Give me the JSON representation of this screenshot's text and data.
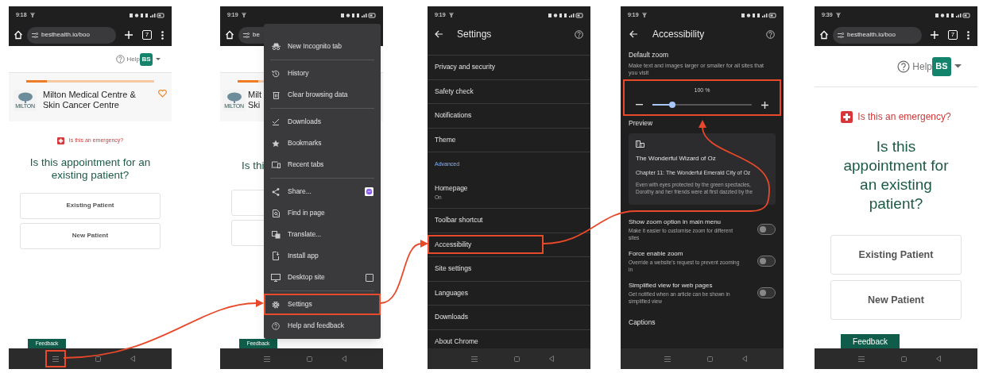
{
  "screens": [
    {
      "kind": "booking",
      "status_time": "9:18",
      "url": "besthealth.io/boo",
      "tab_count": "7",
      "help": "Help",
      "avatar": "BS",
      "clinic": {
        "name": "Milton Medical Centre & Skin Cancer Centre",
        "logo_text": "MILTON",
        "level": 0.16
      },
      "emergency": "Is this an emergency?",
      "question": "Is this appointment for an existing patient?",
      "options": [
        "Existing Patient",
        "New Patient"
      ],
      "feedback": "Feedback",
      "nav_highlighted": true
    },
    {
      "kind": "menu",
      "status_time": "9:19",
      "url": "be",
      "clinic": {
        "name_lines": [
          "Milt",
          "Ski"
        ],
        "logo_text": "MILTON",
        "level": 0.16
      },
      "question": "Is thi",
      "feedback": "Feedback",
      "menu": [
        {
          "kind": "item",
          "label": "New Incognito tab",
          "highlighted": false
        },
        {
          "kind": "divider"
        },
        {
          "kind": "item",
          "label": "History",
          "highlighted": false
        },
        {
          "kind": "item",
          "label": "Clear browsing data",
          "highlighted": false
        },
        {
          "kind": "divider"
        },
        {
          "kind": "item",
          "label": "Downloads",
          "highlighted": false
        },
        {
          "kind": "item",
          "label": "Bookmarks",
          "highlighted": false
        },
        {
          "kind": "item",
          "label": "Recent tabs",
          "highlighted": false
        },
        {
          "kind": "divider"
        },
        {
          "kind": "share",
          "label": "Share...",
          "highlighted": false
        },
        {
          "kind": "item",
          "label": "Find in page",
          "highlighted": false
        },
        {
          "kind": "item",
          "label": "Translate...",
          "highlighted": false
        },
        {
          "kind": "item",
          "label": "Install app",
          "highlighted": false
        },
        {
          "kind": "checkbox",
          "label": "Desktop site",
          "checked": false,
          "highlighted": false
        },
        {
          "kind": "divider"
        },
        {
          "kind": "item",
          "label": "Settings",
          "highlighted": true
        },
        {
          "kind": "item",
          "label": "Help and feedback",
          "highlighted": false
        }
      ]
    },
    {
      "kind": "settings",
      "status_time": "9:19",
      "title": "Settings",
      "items": [
        {
          "kind": "row",
          "label": "Privacy and security",
          "highlighted": false
        },
        {
          "kind": "row",
          "label": "Safety check",
          "highlighted": false
        },
        {
          "kind": "row",
          "label": "Notifications",
          "highlighted": false
        },
        {
          "kind": "row",
          "label": "Theme",
          "highlighted": false
        },
        {
          "kind": "section",
          "label": "Advanced"
        },
        {
          "kind": "row",
          "label": "Homepage",
          "sub": "On",
          "highlighted": false
        },
        {
          "kind": "row",
          "label": "Toolbar shortcut",
          "highlighted": false
        },
        {
          "kind": "row",
          "label": "Accessibility",
          "highlighted": true
        },
        {
          "kind": "row",
          "label": "Site settings",
          "highlighted": false
        },
        {
          "kind": "row",
          "label": "Languages",
          "highlighted": false
        },
        {
          "kind": "row",
          "label": "Downloads",
          "highlighted": false
        },
        {
          "kind": "row",
          "label": "About Chrome",
          "highlighted": false
        }
      ]
    },
    {
      "kind": "accessibility",
      "status_time": "9:19",
      "title": "Accessibility",
      "zoom": {
        "label": "Default zoom",
        "description": "Make text and images larger or smaller for all sites that you visit",
        "reading": "100 %",
        "level": 0.2,
        "highlighted": true
      },
      "preview": {
        "label": "Preview",
        "title": "The Wonderful Wizard of Oz",
        "chapter": "Chapter 11: The Wonderful Emerald City of Oz",
        "body": "Even with eyes protected by the green spectacles, Dorothy and her friends were at first dazzled by the"
      },
      "toggles": [
        {
          "title": "Show zoom option in main menu",
          "description": "Make it easier to customise zoom for different sites",
          "on": false
        },
        {
          "title": "Force enable zoom",
          "description": "Override a website's request to prevent zooming in",
          "on": false
        },
        {
          "title": "Simplified view for web pages",
          "description": "Get notified when an article can be shown in simplified view",
          "on": false
        }
      ],
      "captions": "Captions"
    },
    {
      "kind": "booking_zoomed",
      "status_time": "9:39",
      "url": "besthealth.io/boo",
      "tab_count": "7",
      "help": "Help",
      "avatar": "BS",
      "emergency": "Is this an emergency?",
      "question": "Is this appointment for an existing patient?",
      "options": [
        "Existing Patient",
        "New Patient"
      ],
      "feedback": "Feedback",
      "nav_highlighted": false
    }
  ]
}
